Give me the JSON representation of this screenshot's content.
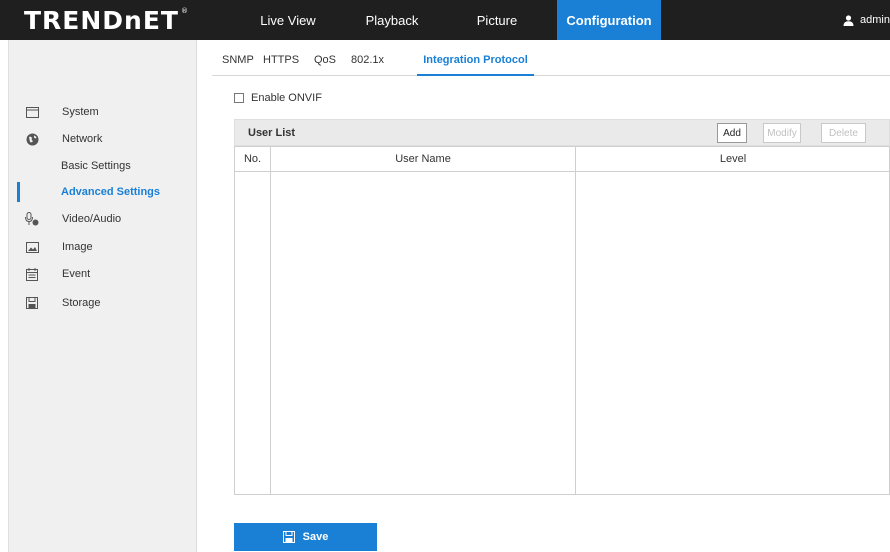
{
  "brand": {
    "logo_text": "TRENDnET",
    "reg_mark": "®"
  },
  "nav": {
    "live_view": "Live View",
    "playback": "Playback",
    "picture": "Picture",
    "configuration": "Configuration",
    "active": "configuration"
  },
  "user": {
    "name": "admin",
    "icon": "user-icon"
  },
  "sidebar": {
    "items": [
      {
        "label": "System",
        "icon": "system-icon"
      },
      {
        "label": "Network",
        "icon": "network-globe-icon"
      },
      {
        "label": "Basic Settings",
        "sub": true
      },
      {
        "label": "Advanced Settings",
        "sub": true,
        "active": true
      },
      {
        "label": "Video/Audio",
        "icon": "video-audio-icon"
      },
      {
        "label": "Image",
        "icon": "image-icon"
      },
      {
        "label": "Event",
        "icon": "event-calendar-icon"
      },
      {
        "label": "Storage",
        "icon": "storage-icon"
      }
    ]
  },
  "tabs": [
    {
      "label": "SNMP"
    },
    {
      "label": "HTTPS"
    },
    {
      "label": "QoS"
    },
    {
      "label": "802.1x"
    },
    {
      "label": "Integration Protocol",
      "active": true
    }
  ],
  "onvif": {
    "label": "Enable ONVIF",
    "checked": false
  },
  "user_list": {
    "title": "User List",
    "buttons": {
      "add": "Add",
      "modify": "Modify",
      "delete": "Delete"
    },
    "columns": {
      "no": "No.",
      "user_name": "User Name",
      "level": "Level"
    },
    "rows": []
  },
  "save": {
    "label": "Save",
    "icon": "save-disk-icon"
  },
  "colors": {
    "accent": "#1a80d6",
    "topbar": "#1f1f1f",
    "sidebar_bg": "#f0f0f0"
  }
}
